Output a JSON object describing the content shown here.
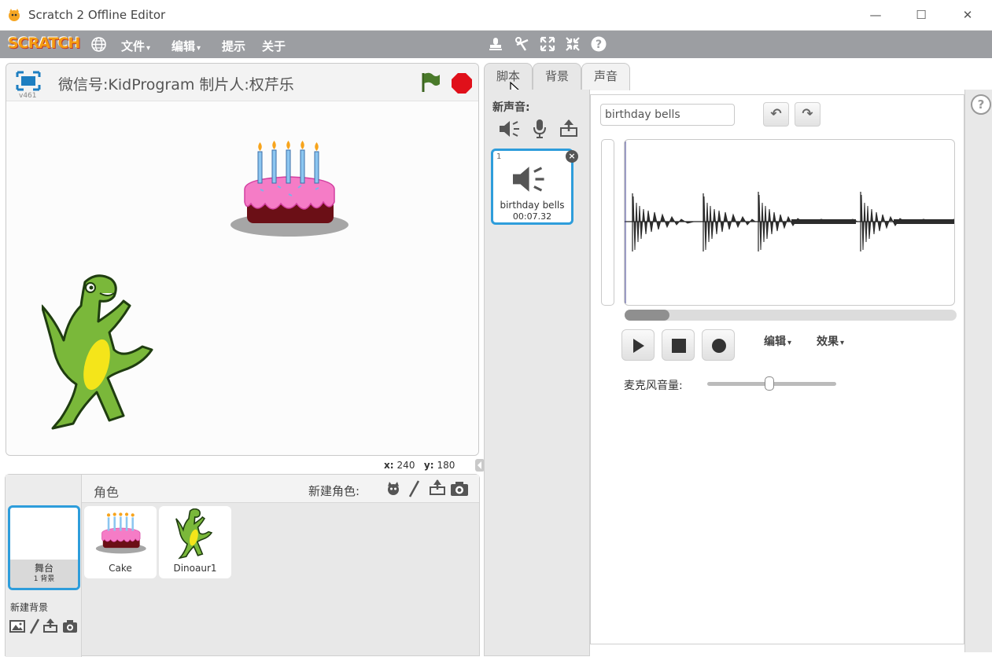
{
  "window": {
    "title": "Scratch 2 Offline Editor",
    "minimize": "—",
    "maximize": "☐",
    "close": "✕"
  },
  "menubar": {
    "logo": "SCRATCH",
    "items": [
      {
        "label": "文件",
        "caret": "▾"
      },
      {
        "label": "编辑",
        "caret": "▾"
      },
      {
        "label": "提示"
      },
      {
        "label": "关于"
      }
    ]
  },
  "stage": {
    "version": "v461",
    "title": "微信号:KidProgram 制片人:权芹乐",
    "coords": {
      "x_label": "x:",
      "x": "240",
      "y_label": "y:",
      "y": "180"
    }
  },
  "sprites": {
    "header": "角色",
    "new_sprite_label": "新建角色:",
    "stage_thumb": {
      "label": "舞台",
      "sub": "1 背景"
    },
    "new_backdrop_label": "新建背景",
    "items": [
      {
        "name": "Cake"
      },
      {
        "name": "Dinoaur1"
      }
    ]
  },
  "tabs": [
    {
      "label": "脚本"
    },
    {
      "label": "背景"
    },
    {
      "label": "声音"
    }
  ],
  "sounds": {
    "new_label": "新声音:",
    "items": [
      {
        "index": "1",
        "name": "birthday bells",
        "duration": "00:07.32"
      }
    ]
  },
  "editor": {
    "sound_name": "birthday bells",
    "undo": "↶",
    "redo": "↷",
    "edit_menu": "编辑",
    "effects_menu": "效果",
    "caret": "▾",
    "mic_label": "麦克风音量:",
    "mic_volume": 0.48,
    "scroll_position": 0.0,
    "help": "?"
  },
  "colors": {
    "menubar": "#9c9ea2",
    "selection_blue": "#2e9ddb",
    "flag_green": "#4a7a2a",
    "stop_red": "#e0101a"
  }
}
